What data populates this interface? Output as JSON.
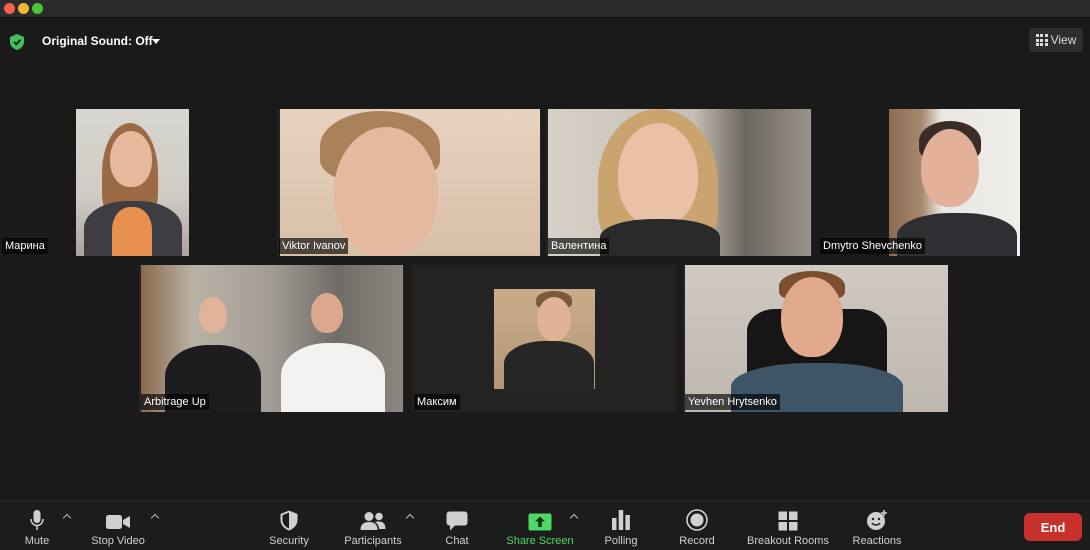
{
  "header": {
    "original_sound_label": "Original Sound: Off",
    "view_label": "View"
  },
  "participants": [
    {
      "name": "Марина"
    },
    {
      "name": "Viktor Ivanov"
    },
    {
      "name": "Валентина"
    },
    {
      "name": "Dmytro Shevchenko"
    },
    {
      "name": "Arbitrage Up"
    },
    {
      "name": "Максим"
    },
    {
      "name": "Yevhen Hrytsenko"
    }
  ],
  "toolbar": {
    "mute": "Mute",
    "stop_video": "Stop Video",
    "security": "Security",
    "participants": "Participants",
    "chat": "Chat",
    "share_screen": "Share Screen",
    "polling": "Polling",
    "record": "Record",
    "breakout_rooms": "Breakout Rooms",
    "reactions": "Reactions",
    "end": "End"
  },
  "colors": {
    "share_green": "#4cd964",
    "end_red": "#c8312b",
    "shield_green": "#3fbf5b"
  }
}
